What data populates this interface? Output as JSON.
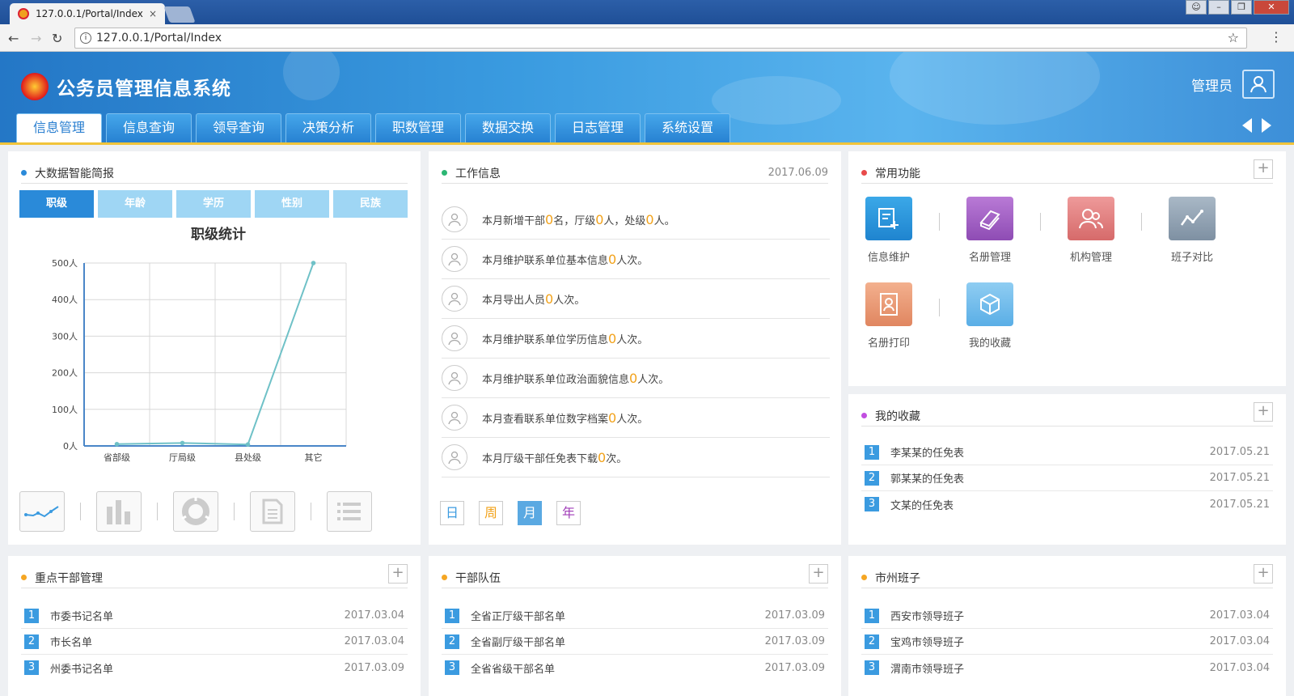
{
  "browser": {
    "tab_title": "127.0.0.1/Portal/Index",
    "tab_close": "×",
    "url": "127.0.0.1/Portal/Index"
  },
  "app": {
    "title": "公务员管理信息系统",
    "user": "管理员"
  },
  "nav": {
    "items": [
      "信息管理",
      "信息查询",
      "领导查询",
      "决策分析",
      "职数管理",
      "数据交换",
      "日志管理",
      "系统设置"
    ],
    "active": "信息管理"
  },
  "bigdata": {
    "title": "大数据智能简报",
    "tabs": [
      "职级",
      "年龄",
      "学历",
      "性别",
      "民族"
    ],
    "active_tab": "职级",
    "chart_title": "职级统计"
  },
  "chart_data": {
    "type": "line",
    "title": "职级统计",
    "categories": [
      "省部级",
      "厅局级",
      "县处级",
      "其它"
    ],
    "x_positions": [
      0.5,
      1.5,
      2.5,
      3.5
    ],
    "series": [
      {
        "values": [
          5,
          8,
          4,
          500
        ]
      }
    ],
    "ylim": [
      0,
      500
    ],
    "yticks": [
      "0人",
      "100人",
      "200人",
      "300人",
      "400人",
      "500人"
    ],
    "xticks": [
      "省部级",
      "厅局级",
      "县处级",
      "其它"
    ],
    "grid": true,
    "line_color": "#6fc1c7"
  },
  "work": {
    "title": "工作信息",
    "date": "2017.06.09",
    "items": [
      {
        "pre": "本月新增干部",
        "n1": "0",
        "mid": "名，厅级",
        "n2": "0",
        "mid2": "人，处级",
        "n3": "0",
        "post": "人。"
      },
      {
        "pre": "本月维护联系单位基本信息",
        "n1": "0",
        "post": "人次。"
      },
      {
        "pre": "本月导出人员",
        "n1": "0",
        "post": "人次。"
      },
      {
        "pre": "本月维护联系单位学历信息",
        "n1": "0",
        "post": "人次。"
      },
      {
        "pre": "本月维护联系单位政治面貌信息",
        "n1": "0",
        "post": "人次。"
      },
      {
        "pre": "本月查看联系单位数字档案",
        "n1": "0",
        "post": "人次。"
      },
      {
        "pre": "本月厅级干部任免表下载",
        "n1": "0",
        "post": "次。"
      }
    ],
    "periods": [
      "日",
      "周",
      "月",
      "年"
    ],
    "active_period": "月"
  },
  "common": {
    "title": "常用功能",
    "plus": "+",
    "items": [
      "信息维护",
      "名册管理",
      "机构管理",
      "班子对比",
      "名册打印",
      "我的收藏"
    ]
  },
  "favorites": {
    "title": "我的收藏",
    "plus": "+",
    "rows": [
      {
        "n": "1",
        "t": "李某某的任免表",
        "d": "2017.05.21"
      },
      {
        "n": "2",
        "t": "郭某某的任免表",
        "d": "2017.05.21"
      },
      {
        "n": "3",
        "t": "文某的任免表",
        "d": "2017.05.21"
      }
    ]
  },
  "keycadre": {
    "title": "重点干部管理",
    "plus": "+",
    "rows": [
      {
        "n": "1",
        "t": "市委书记名单",
        "d": "2017.03.04"
      },
      {
        "n": "2",
        "t": "市长名单",
        "d": "2017.03.04"
      },
      {
        "n": "3",
        "t": "州委书记名单",
        "d": "2017.03.09"
      }
    ]
  },
  "team": {
    "title": "干部队伍",
    "plus": "+",
    "rows": [
      {
        "n": "1",
        "t": "全省正厅级干部名单",
        "d": "2017.03.09"
      },
      {
        "n": "2",
        "t": "全省副厅级干部名单",
        "d": "2017.03.09"
      },
      {
        "n": "3",
        "t": "全省省级干部名单",
        "d": "2017.03.09"
      }
    ]
  },
  "cities": {
    "title": "市州班子",
    "plus": "+",
    "rows": [
      {
        "n": "1",
        "t": "西安市领导班子",
        "d": "2017.03.04"
      },
      {
        "n": "2",
        "t": "宝鸡市领导班子",
        "d": "2017.03.04"
      },
      {
        "n": "3",
        "t": "渭南市领导班子",
        "d": "2017.03.04"
      }
    ]
  },
  "colors": {
    "header_blue": "#2a8ad9",
    "accent_yellow": "#f1c43a",
    "highlight_orange": "#f2a21a",
    "list_num": "#3b9be0"
  }
}
